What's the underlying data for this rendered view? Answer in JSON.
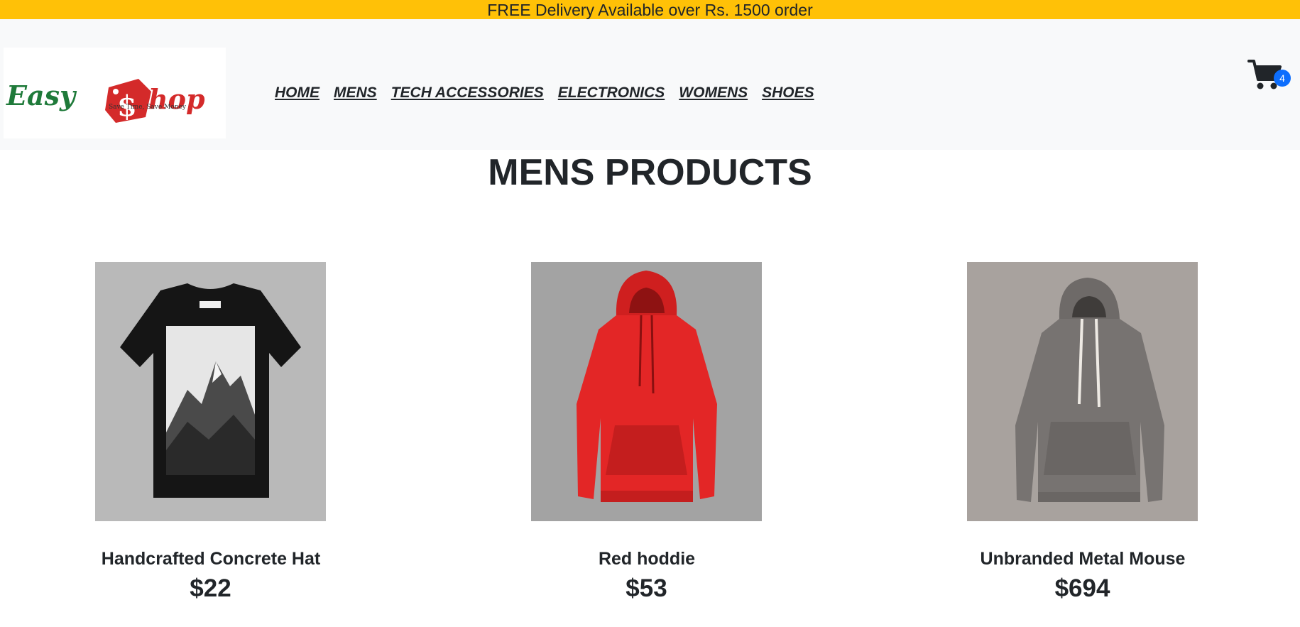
{
  "promo": {
    "text": "FREE Delivery Available over Rs. 1500 order"
  },
  "header": {
    "logo": {
      "name": "EasyShop",
      "word_easy": "Easy",
      "word_shop": "hop",
      "dollar": "$",
      "tagline": "Save Time, Save Money"
    },
    "nav": [
      {
        "label": "HOME"
      },
      {
        "label": "MENS"
      },
      {
        "label": "TECH ACCESSORIES"
      },
      {
        "label": "ELECTRONICS"
      },
      {
        "label": "WOMENS"
      },
      {
        "label": "SHOES"
      }
    ],
    "cart": {
      "icon": "cart-icon",
      "count": "4"
    }
  },
  "page": {
    "title": "MENS PRODUCTS"
  },
  "products": [
    {
      "name": "Handcrafted Concrete Hat",
      "price": "$22",
      "image": "black-tshirt-mountain-print"
    },
    {
      "name": "Red hoddie",
      "price": "$53",
      "image": "red-hoodie"
    },
    {
      "name": "Unbranded Metal Mouse",
      "price": "$694",
      "image": "grey-hoodie"
    }
  ],
  "colors": {
    "promo_bar": "#ffc107",
    "header_bg": "#f8f9fa",
    "badge": "#0d6efd",
    "logo_green": "#1f7a3a",
    "logo_red": "#d42a2a"
  }
}
